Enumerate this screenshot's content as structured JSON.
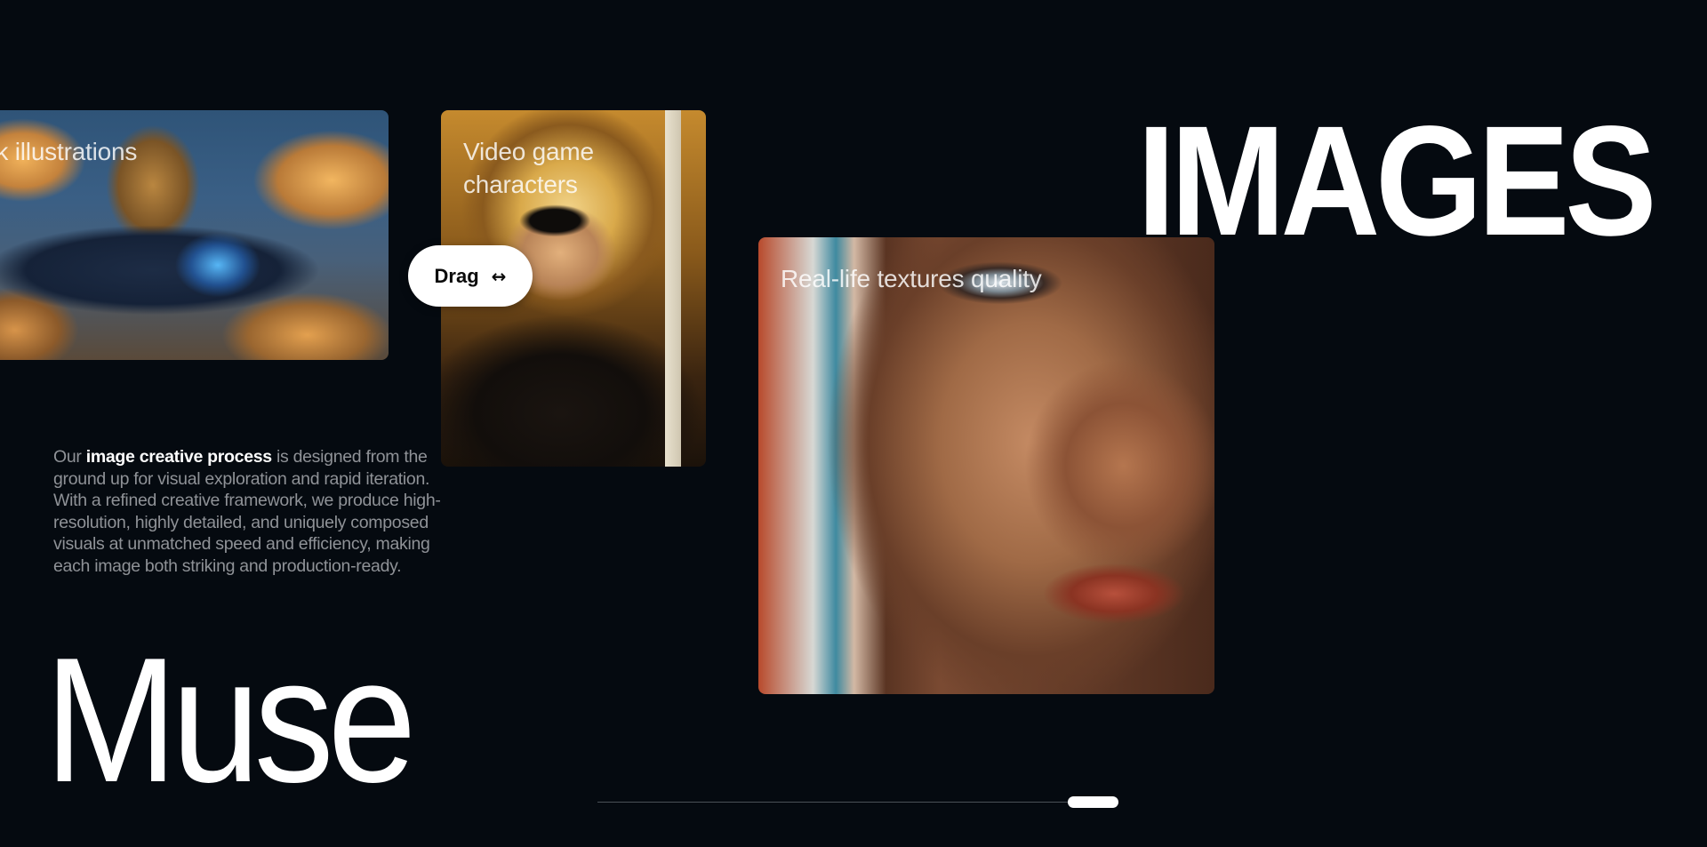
{
  "cards": [
    {
      "caption": "ok illustrations"
    },
    {
      "caption": "Video game characters"
    },
    {
      "caption": "Real-life textures quality"
    }
  ],
  "drag_button": {
    "label": "Drag",
    "icon": "left-right-arrow-icon",
    "icon_glyph": "↔"
  },
  "headline_right": "IMAGES",
  "headline_left": "Muse",
  "description": {
    "before": "Our ",
    "highlight": "image creative process",
    "after": " is designed from the ground up for visual exploration and rapid iteration. With a refined creative framework, we produce high-resolution, highly detailed, and uniquely composed visuals at unmatched speed and efficiency, making each image both striking and production-ready."
  },
  "carousel_progress": {
    "position": 0.95
  },
  "colors": {
    "background": "#050a10",
    "text": "#ffffff",
    "muted_text": "#8f9297"
  }
}
